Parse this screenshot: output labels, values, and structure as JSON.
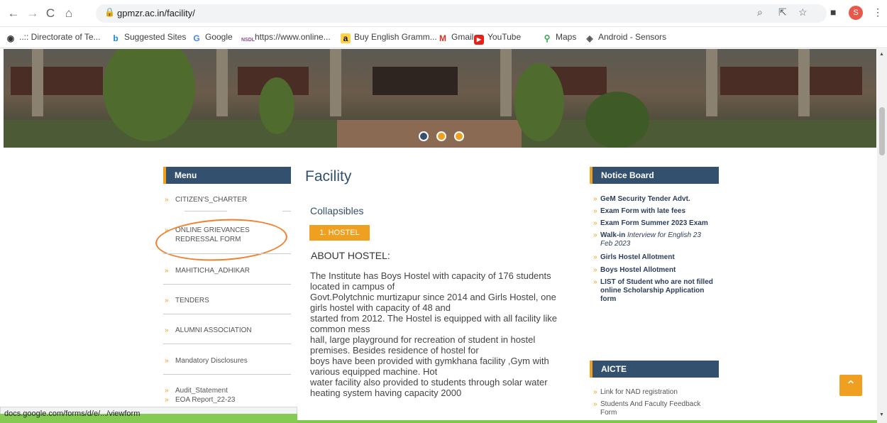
{
  "browser": {
    "url": "gpmzr.ac.in/facility/",
    "profile_initial": "S",
    "bookmarks": [
      {
        "label": "..:: Directorate of Te...",
        "icon": "globe-icon"
      },
      {
        "label": "Suggested Sites",
        "icon": "bing-icon"
      },
      {
        "label": "Google",
        "icon": "google-icon"
      },
      {
        "label": "https://www.online...",
        "icon": "nsdl-icon"
      },
      {
        "label": "Buy English Gramm...",
        "icon": "amazon-icon"
      },
      {
        "label": "Gmail",
        "icon": "gmail-icon"
      },
      {
        "label": "YouTube",
        "icon": "youtube-icon"
      },
      {
        "label": "Maps",
        "icon": "maps-icon"
      },
      {
        "label": "Android - Sensors",
        "icon": "android-icon"
      }
    ],
    "status_url": "docs.google.com/forms/d/e/.../viewform"
  },
  "menu": {
    "title": "Menu",
    "items": [
      "CITIZEN'S_CHARTER",
      "ONLINE GRIEVANCES REDRESSAL FORM",
      "MAHITICHA_ADHIKAR",
      "TENDERS",
      "ALUMNI ASSOCIATION",
      "Mandatory Disclosures",
      "Audit_Statement",
      "EOA Report_22-23"
    ]
  },
  "main": {
    "title": "Facility",
    "collapsibles": "Collapsibles",
    "hostel_button": "1. HOSTEL",
    "about_heading": "ABOUT HOSTEL:",
    "paragraphs": [
      "The Institute has Boys Hostel  with capacity of 176 students located in campus of",
      "Govt.Polytchnic murtizapur since 2014 and Girls Hostel, one  girls hostel with capacity of 48 and",
      "started from 2012.  The Hostel is equipped with all facility like common mess",
      "hall, large playground for recreation of student in hostel premises. Besides residence of hostel for",
      "boys  have been provided with gymkhana facility ,Gym with various equipped machine. Hot",
      "water facility also provided to students through solar water heating system having capacity 2000"
    ]
  },
  "notice_board": {
    "title": "Notice Board",
    "items": [
      {
        "text": "GeM Security Tender Advt.",
        "italic": ""
      },
      {
        "text": "Exam Form with late fees",
        "italic": ""
      },
      {
        "text": "Exam Form Summer 2023 Exam",
        "italic": ""
      },
      {
        "text": "Walk-in ",
        "italic": "Interview for English 23 Feb 2023"
      },
      {
        "text": "Girls Hostel Allotment",
        "italic": ""
      },
      {
        "text": "Boys Hostel Allotment",
        "italic": ""
      },
      {
        "text": "LIST of Student who are not filled online Scholarship  Application form",
        "italic": ""
      }
    ]
  },
  "aicte": {
    "title": "AICTE",
    "items": [
      "Link for NAD registration",
      "Students And Faculty Feedback Form"
    ]
  },
  "colors": {
    "accent": "#f0a020",
    "header_blue": "#34506f",
    "annotation": "#f37e2b"
  }
}
